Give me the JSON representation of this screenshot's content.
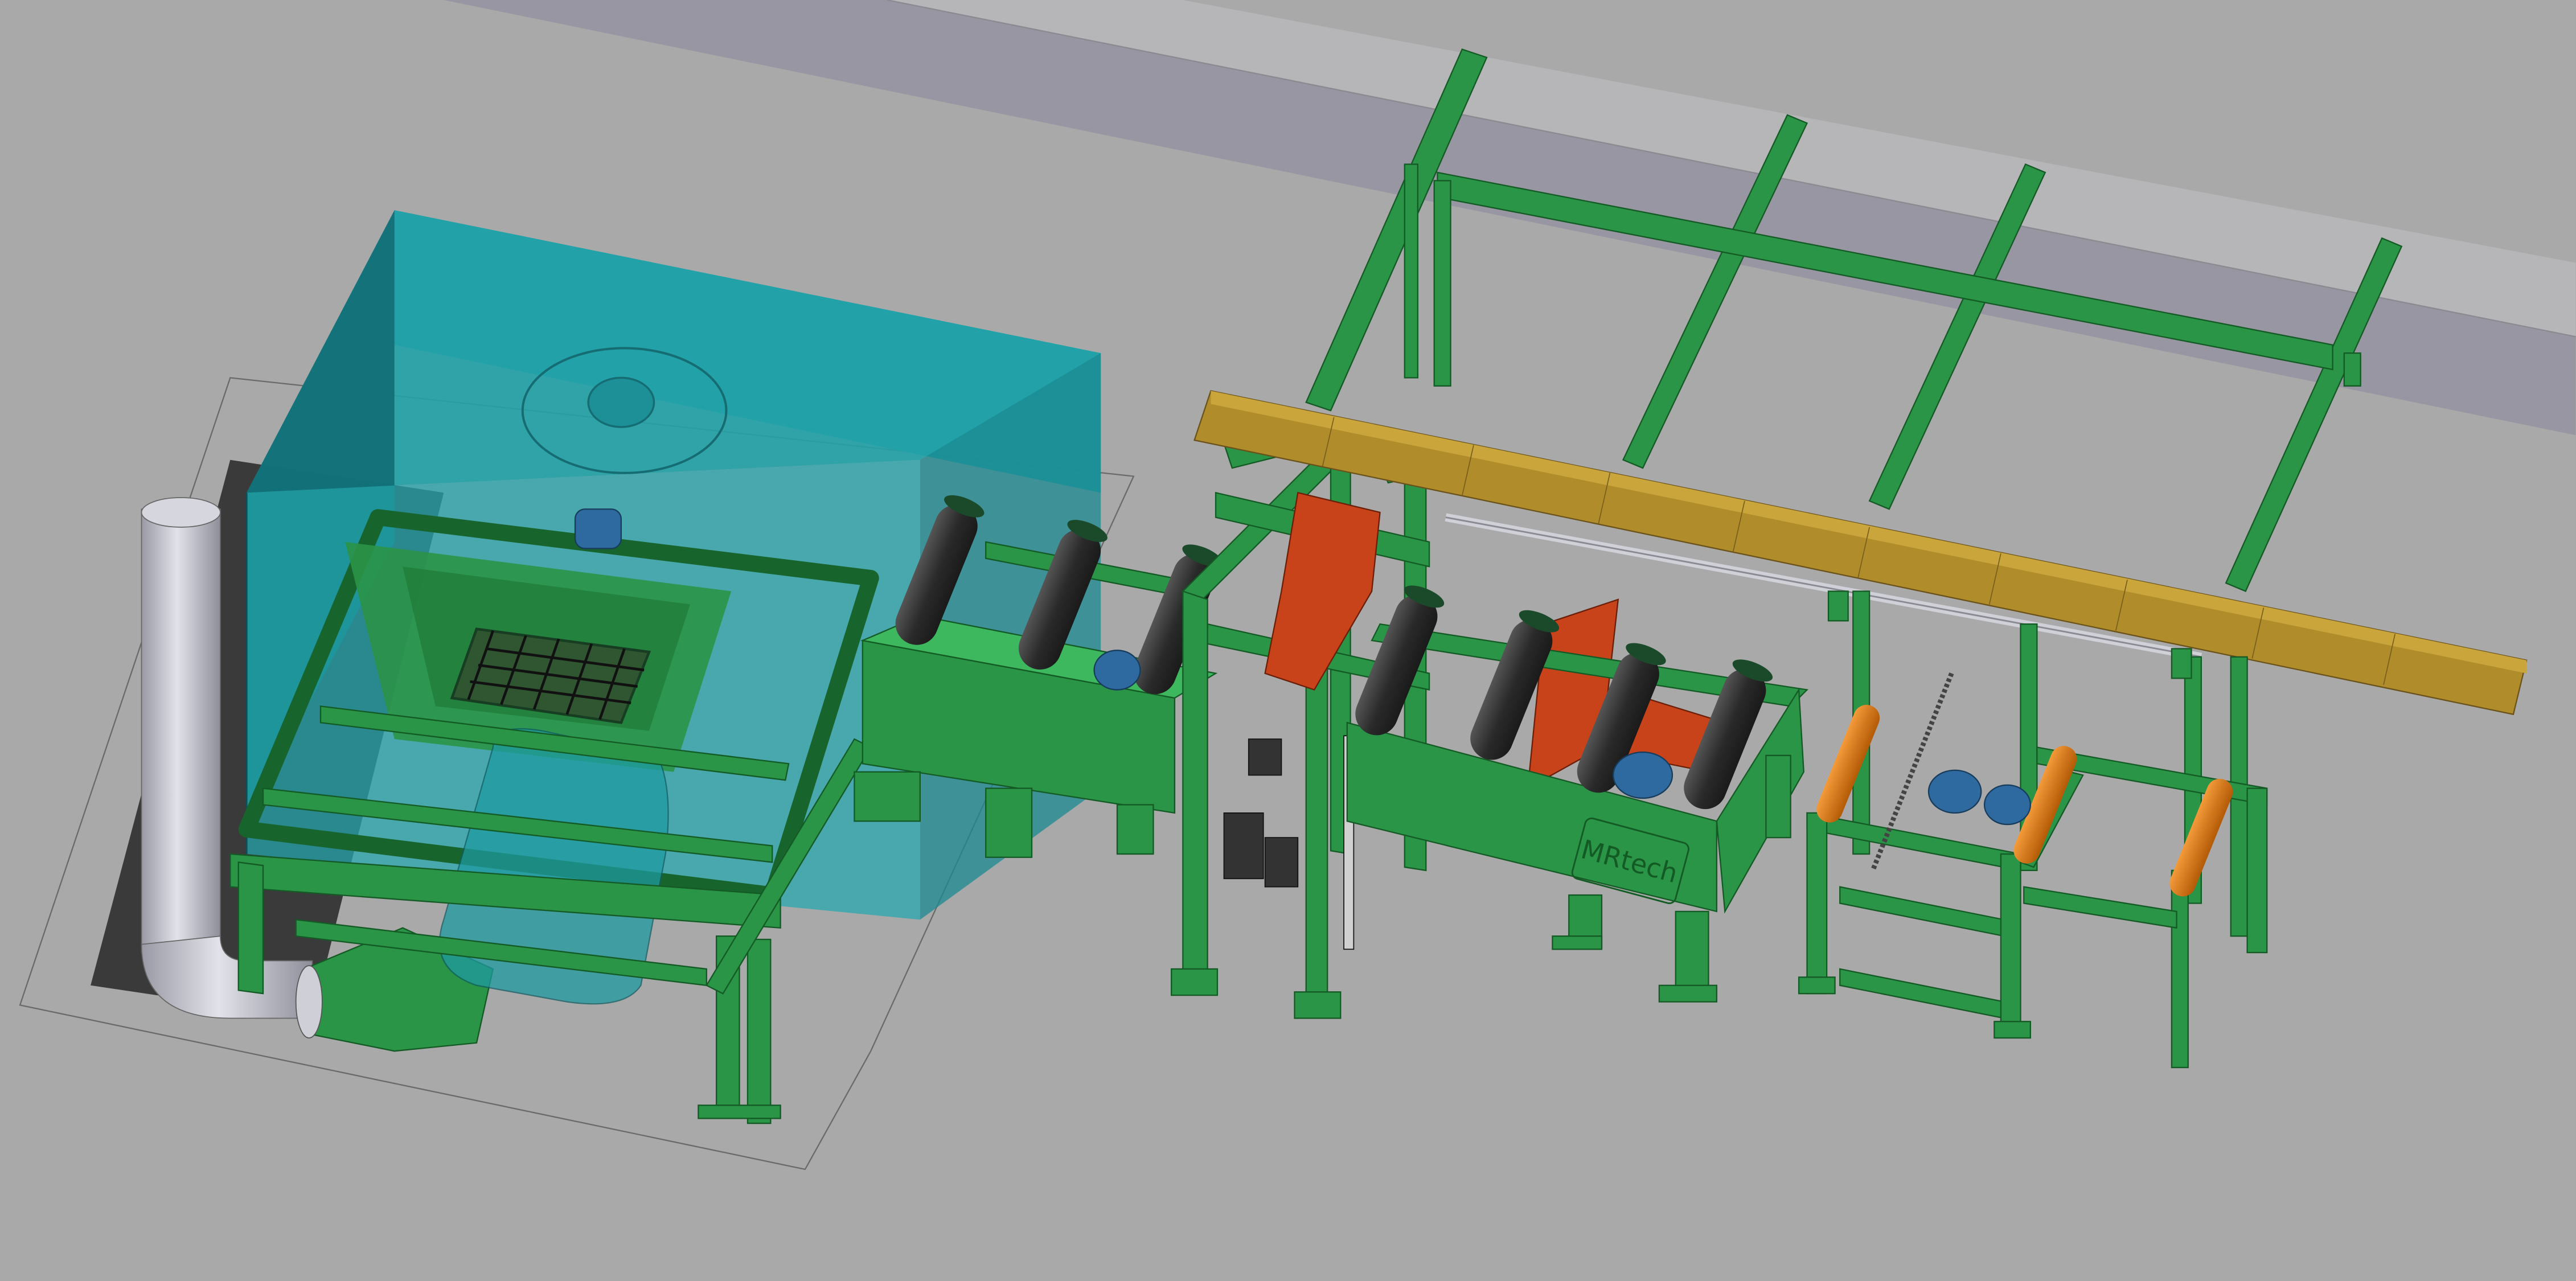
{
  "brand_label": "MRtech",
  "colors": {
    "background": "#a9a9a9",
    "walkway": "#9896a2",
    "walkway_light": "#b6b6b8",
    "frame_green": "#2a9447",
    "frame_green_dark": "#17642c",
    "frame_green_light": "#3db85e",
    "glass_teal": "#1f9fa6",
    "roller_black": "#303030",
    "roller_orange": "#d9740f",
    "motor_blue": "#2e6aa0",
    "arm_red": "#c8431a",
    "board_gold": "#b08d2a",
    "pipe_grey": "#c8c8d2"
  },
  "icons": [
    "mrtech-logo-icon",
    "motor-icon"
  ]
}
